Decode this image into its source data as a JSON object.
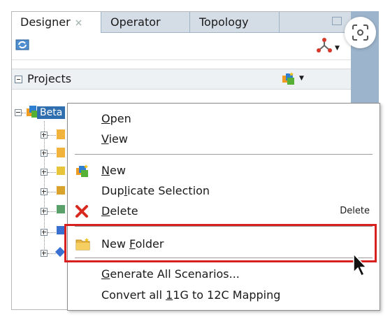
{
  "tabs": [
    {
      "label": "Designer",
      "close": "×",
      "active": true
    },
    {
      "label": "Operator",
      "active": false
    },
    {
      "label": "Topology",
      "active": false
    }
  ],
  "projects_header": {
    "label": "Projects"
  },
  "tree": {
    "root_label": "Beta"
  },
  "context_menu": {
    "items": [
      {
        "pre": "",
        "mnemonic": "O",
        "post": "pen",
        "icon": "",
        "shortcut": ""
      },
      {
        "pre": "",
        "mnemonic": "V",
        "post": "iew",
        "icon": "",
        "shortcut": ""
      },
      {
        "pre": "",
        "mnemonic": "N",
        "post": "ew",
        "icon": "new-icon",
        "shortcut": ""
      },
      {
        "pre": "Dup",
        "mnemonic": "l",
        "post": "icate Selection",
        "icon": "",
        "shortcut": ""
      },
      {
        "pre": "",
        "mnemonic": "D",
        "post": "elete",
        "icon": "delete-x-icon",
        "shortcut": "Delete"
      },
      {
        "pre": "New ",
        "mnemonic": "F",
        "post": "older",
        "icon": "folder-icon",
        "shortcut": ""
      },
      {
        "pre": "",
        "mnemonic": "G",
        "post": "enerate All Scenarios...",
        "icon": "",
        "shortcut": ""
      },
      {
        "pre": "Convert all ",
        "mnemonic": "1",
        "post": "1G to 12C Mapping",
        "icon": "",
        "shortcut": ""
      }
    ]
  },
  "colors": {
    "highlight": "#d8201f",
    "selection": "#2f6fb0",
    "tab_bar": "#d4dce6"
  }
}
